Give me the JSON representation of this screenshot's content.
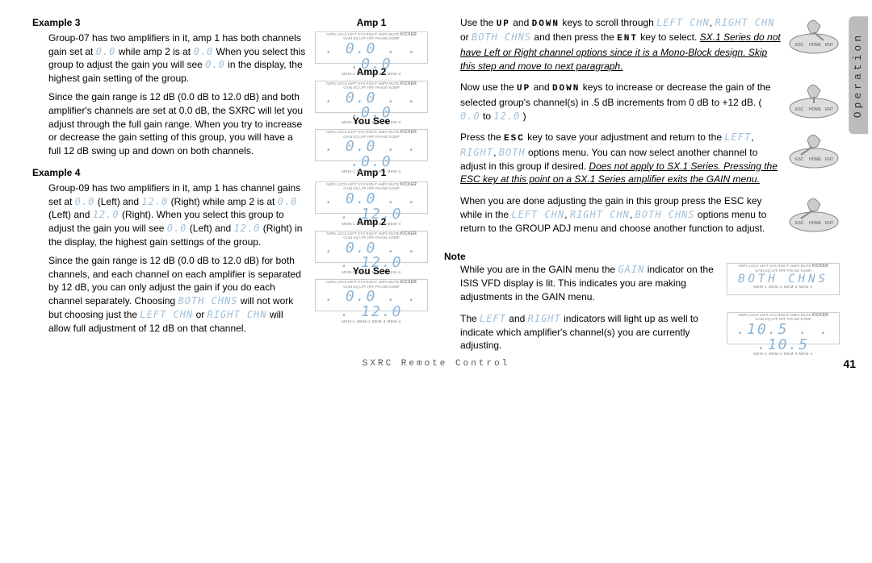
{
  "side_tab": "Operation",
  "footer": "SXRC Remote Control",
  "page_number": "41",
  "lcd_meta": {
    "topline": "AMP1  LOCK  LEFT  SYS  RIGHT  AMP2  MUTE",
    "gainline": "GAIN  EQ  LPF  HPF  PHASE  KOMP",
    "bottomline": "MEM-1  MEM-2  MEM-3  MEM-4",
    "brand": "KICKER"
  },
  "ex3": {
    "heading": "Example 3",
    "p1a": "Group-07 has two amplifiers in it, amp 1 has both channels gain set at ",
    "seg1": "0.0",
    "p1b": " while amp 2 is at ",
    "seg2": "0.0",
    "p1c": "   When you select this group to adjust the gain you will see ",
    "seg3": "0.0",
    "p1d": "   in the display, the highest gain setting of the group.",
    "p2": "Since the gain range is 12 dB (0.0 dB to 12.0 dB) and both amplifier's channels are set at 0.0 dB, the SXRC will let you adjust through the full gain range. When you try to increase or decrease the gain setting of this group, you will have a full 12 dB swing up and down on both channels.",
    "labels": {
      "amp1": "Amp 1",
      "amp2": "Amp 2",
      "yousee": "You See"
    },
    "d1": ". 0.0 .  .   .0.0",
    "d2": ". 0.0 .  .   .0.0",
    "d3": ". 0.0 .  .   .0.0"
  },
  "ex4": {
    "heading": "Example 4",
    "p1a": "Group-09 has two amplifiers in it, amp 1 has channel gains set at ",
    "seg1": "0.0",
    "p1b": " (Left) and ",
    "seg2": "12.0",
    "p1c": " (Right) while amp 2 is at ",
    "seg3": "0.0",
    "p1d": " (Left)  and ",
    "seg4": "12.0",
    "p1e": " (Right). When you select this group to adjust the gain you will see ",
    "seg5": "0.0",
    "p1f": " (Left) and ",
    "seg6": "12.0",
    "p1g": " (Right) in the display, the highest gain settings of the group.",
    "p2a": "Since the gain range is 12 dB (0.0 dB to 12.0 dB) for both channels, and each channel on each amplifier is separated by 12 dB, you can only adjust the gain if you do each channel separately. Choosing ",
    "seg_both": "BOTH CHNS",
    "p2b": " will not work but choosing just the ",
    "seg_left": "LEFT CHN",
    "p2c": " or ",
    "seg_right": "RIGHT CHN",
    "p2d": " will allow full adjustment of 12 dB on that channel.",
    "labels": {
      "amp1": "Amp 1",
      "amp2": "Amp 2",
      "yousee": "You See"
    },
    "d1": ". 0.0 .  .  . 12.0",
    "d2": ". 0.0 .  .  . 12.0",
    "d3": ". 0.0 .  .  . 12.0"
  },
  "right": {
    "p1a": "Use the ",
    "key_up": "UP",
    "p1b": " and ",
    "key_down": "DOWN",
    "p1c": " keys to scroll through ",
    "seg_l": "LEFT CHN",
    "seg_r": "RIGHT CHN",
    "or": " or ",
    "seg_b": "BOTH CHNS",
    "p1d": " and then press the ",
    "key_ent": "ENT",
    "p1e": " key to select. ",
    "ital1": "SX.1 Series do not have Left or Right channel options since it is a Mono-Block design. Skip this step and move to next paragraph.",
    "p2a": "Now use the ",
    "p2b": " keys to increase or decrease the gain of the selected group's channel(s) in .5 dB increments from 0 dB to +12 dB. (",
    "seg_00": "0.0",
    "p2c": " to   ",
    "seg_120": "12.0",
    "p2d": ")",
    "p3a": "Press the ",
    "key_esc": "ESC",
    "p3b": " key to save your adjustment and return to the ",
    "seg_left2": "LEFT",
    "seg_right2": "RIGHT",
    "seg_both2": "BOTH",
    "p3c": " options menu. You can now select another channel to adjust in this group if desired. ",
    "ital3": "Does not apply to SX.1 Series. Pressing the ESC key at this point on a SX.1 Series amplifier exits the GAIN menu.",
    "p4a": "When you are done adjusting the gain in this group press the ESC key while in the ",
    "seg_lchn": "LEFT CHN",
    "seg_rchn": "RIGHT CHN",
    "seg_bchn": "BOTH CHNS",
    "p4b": " options menu to return to the GROUP ADJ menu and choose another function to adjust.",
    "note": "Note",
    "n1a": "While you are in the GAIN menu the ",
    "seg_gain": "GAIN",
    "n1b": " indicator on the ISIS VFD display is lit. This indicates you are making adjustments in the GAIN menu.",
    "n2a": "The ",
    "seg_left3": "LEFT",
    "n2b": " and ",
    "seg_right3": "RIGHT",
    "n2c": " indicators will light up as well to indicate which amplifier's channel(s) you are currently adjusting.",
    "note_d1": "BOTH  CHNS",
    "note_d2": ".10.5 . . .10.5"
  },
  "remote_labels": {
    "esc": "ESC",
    "home": "HOME",
    "ent": "ENT"
  }
}
